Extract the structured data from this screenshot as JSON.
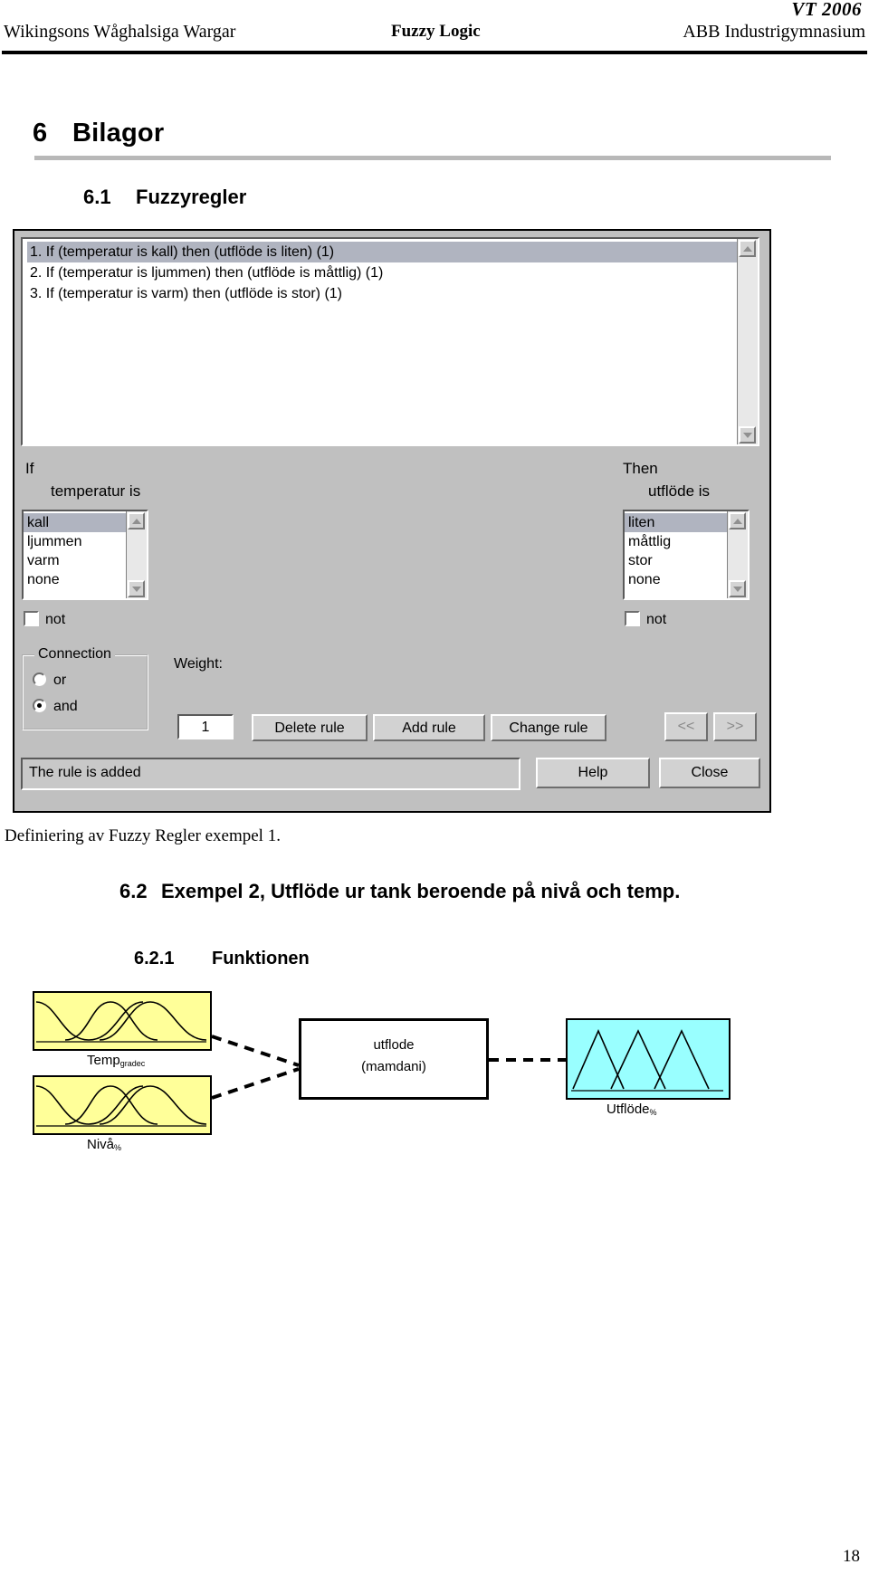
{
  "header": {
    "term": "VT 2006",
    "left": "Wikingsons Wåghalsiga Wargar",
    "center": "Fuzzy Logic",
    "right": "ABB Industrigymnasium"
  },
  "headings": {
    "h1_num": "6",
    "h1_text": "Bilagor",
    "h2_num": "6.1",
    "h2_text": "Fuzzyregler",
    "h2b_num": "6.2",
    "h2b_text": "Exempel 2, Utflöde ur tank beroende på nivå och temp.",
    "h3_num": "6.2.1",
    "h3_text": "Funktionen"
  },
  "caption": "Definiering av Fuzzy Regler exempel 1.",
  "page_number": "18",
  "rule_editor": {
    "rules": [
      {
        "text": "1. If (temperatur is kall) then (utflöde is liten) (1)",
        "selected": true
      },
      {
        "text": "2. If (temperatur is ljummen) then (utflöde is måttlig) (1)",
        "selected": false
      },
      {
        "text": "3. If (temperatur is varm) then (utflöde is stor) (1)",
        "selected": false
      }
    ],
    "if_label": "If",
    "if_variable": "temperatur is",
    "then_label": "Then",
    "then_variable": "utflöde is",
    "if_items": [
      {
        "label": "kall",
        "selected": true
      },
      {
        "label": "ljummen",
        "selected": false
      },
      {
        "label": "varm",
        "selected": false
      },
      {
        "label": "none",
        "selected": false
      }
    ],
    "then_items": [
      {
        "label": "liten",
        "selected": true
      },
      {
        "label": "måttlig",
        "selected": false
      },
      {
        "label": "stor",
        "selected": false
      },
      {
        "label": "none",
        "selected": false
      }
    ],
    "not_if_label": "not",
    "not_then_label": "not",
    "connection_title": "Connection",
    "connection_or": "or",
    "connection_and": "and",
    "connection_selected": "and",
    "weight_label": "Weight:",
    "weight_value": "1",
    "buttons": {
      "delete_rule": "Delete rule",
      "add_rule": "Add rule",
      "change_rule": "Change rule",
      "prev": "<<",
      "next": ">>",
      "help": "Help",
      "close": "Close"
    },
    "status": "The rule is added"
  },
  "fis_diagram": {
    "input1_label": "Temp",
    "input1_unit": "gradec",
    "input2_label": "Nivå",
    "input2_unit": "%",
    "center_line1": "utflode",
    "center_line2": "(mamdani)",
    "output_label": "Utflöde",
    "output_unit": "%",
    "colors": {
      "input_fill": "#ffff99",
      "output_fill": "#99ffff",
      "stroke": "#000000"
    }
  }
}
